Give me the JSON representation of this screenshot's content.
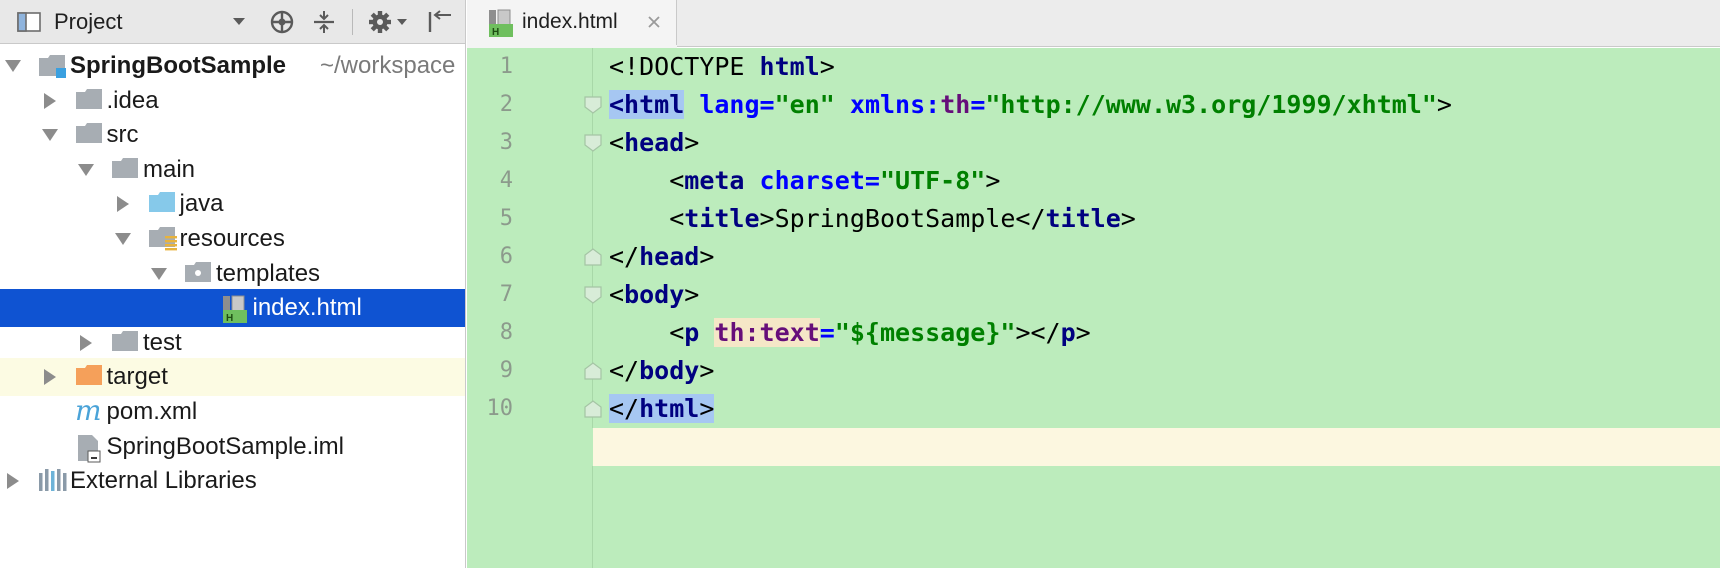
{
  "project_panel": {
    "title": "Project",
    "tree": [
      {
        "label": "SpringBootSample",
        "path": "~/workspace",
        "bold": true,
        "depth": 0,
        "expanded": true,
        "icon": "module-icon"
      },
      {
        "label": ".idea",
        "depth": 1,
        "expanded": false,
        "icon": "folder-icon"
      },
      {
        "label": "src",
        "depth": 1,
        "expanded": true,
        "icon": "folder-icon"
      },
      {
        "label": "main",
        "depth": 2,
        "expanded": true,
        "icon": "folder-icon"
      },
      {
        "label": "java",
        "depth": 3,
        "expanded": false,
        "icon": "source-folder-icon"
      },
      {
        "label": "resources",
        "depth": 3,
        "expanded": true,
        "icon": "resources-folder-icon"
      },
      {
        "label": "templates",
        "depth": 4,
        "expanded": true,
        "icon": "package-folder-icon"
      },
      {
        "label": "index.html",
        "depth": 5,
        "selected": true,
        "icon": "html-file-icon"
      },
      {
        "label": "test",
        "depth": 2,
        "expanded": false,
        "icon": "folder-icon"
      },
      {
        "label": "target",
        "depth": 1,
        "expanded": false,
        "icon": "excluded-folder-icon"
      },
      {
        "label": "pom.xml",
        "depth": 1,
        "icon": "maven-icon"
      },
      {
        "label": "SpringBootSample.iml",
        "depth": 1,
        "icon": "iml-file-icon"
      },
      {
        "label": "External Libraries",
        "depth": 0,
        "expanded": false,
        "icon": "libraries-icon"
      }
    ]
  },
  "editor": {
    "tab": {
      "label": "index.html"
    },
    "lines": [
      {
        "no": "1",
        "tokens": [
          {
            "t": "<!DOCTYPE ",
            "c": "punct"
          },
          {
            "t": "html",
            "c": "tag"
          },
          {
            "t": ">",
            "c": "punct"
          }
        ]
      },
      {
        "no": "2",
        "tokens": [
          {
            "t": "<html",
            "c": "tag",
            "hl": "blue"
          },
          {
            "t": " ",
            "c": "punct"
          },
          {
            "t": "lang",
            "c": "attr"
          },
          {
            "t": "=",
            "c": "attr"
          },
          {
            "t": "\"en\"",
            "c": "str"
          },
          {
            "t": " ",
            "c": "punct"
          },
          {
            "t": "xmlns:",
            "c": "attr"
          },
          {
            "t": "th",
            "c": "ns"
          },
          {
            "t": "=",
            "c": "attr"
          },
          {
            "t": "\"http://www.w3.org/1999/xhtml\"",
            "c": "str"
          },
          {
            "t": ">",
            "c": "punct"
          }
        ]
      },
      {
        "no": "3",
        "tokens": [
          {
            "t": "<",
            "c": "punct"
          },
          {
            "t": "head",
            "c": "tag"
          },
          {
            "t": ">",
            "c": "punct"
          }
        ]
      },
      {
        "no": "4",
        "tokens": [
          {
            "t": "    <",
            "c": "punct"
          },
          {
            "t": "meta",
            "c": "tag"
          },
          {
            "t": " ",
            "c": "punct"
          },
          {
            "t": "charset",
            "c": "attr"
          },
          {
            "t": "=",
            "c": "attr"
          },
          {
            "t": "\"UTF-8\"",
            "c": "str"
          },
          {
            "t": ">",
            "c": "punct"
          }
        ]
      },
      {
        "no": "5",
        "tokens": [
          {
            "t": "    <",
            "c": "punct"
          },
          {
            "t": "title",
            "c": "tag"
          },
          {
            "t": ">SpringBootSample</",
            "c": "text"
          },
          {
            "t": "title",
            "c": "tag"
          },
          {
            "t": ">",
            "c": "punct"
          }
        ]
      },
      {
        "no": "6",
        "tokens": [
          {
            "t": "</",
            "c": "punct"
          },
          {
            "t": "head",
            "c": "tag"
          },
          {
            "t": ">",
            "c": "punct"
          }
        ]
      },
      {
        "no": "7",
        "tokens": [
          {
            "t": "<",
            "c": "punct"
          },
          {
            "t": "body",
            "c": "tag"
          },
          {
            "t": ">",
            "c": "punct"
          }
        ]
      },
      {
        "no": "8",
        "tokens": [
          {
            "t": "    <",
            "c": "punct"
          },
          {
            "t": "p",
            "c": "tag"
          },
          {
            "t": " ",
            "c": "punct"
          },
          {
            "t": "th:text",
            "c": "ns",
            "hl": "yellow"
          },
          {
            "t": "=",
            "c": "attr"
          },
          {
            "t": "\"${message}\"",
            "c": "str"
          },
          {
            "t": "></",
            "c": "punct"
          },
          {
            "t": "p",
            "c": "tag"
          },
          {
            "t": ">",
            "c": "punct"
          }
        ]
      },
      {
        "no": "9",
        "tokens": [
          {
            "t": "</",
            "c": "punct"
          },
          {
            "t": "body",
            "c": "tag"
          },
          {
            "t": ">",
            "c": "punct"
          }
        ]
      },
      {
        "no": "10",
        "tokens": [
          {
            "t": "</",
            "c": "punct",
            "hl": "blue"
          },
          {
            "t": "html",
            "c": "tag",
            "hl": "blue"
          },
          {
            "t": ">",
            "c": "punct",
            "hl": "blue"
          }
        ]
      }
    ]
  }
}
